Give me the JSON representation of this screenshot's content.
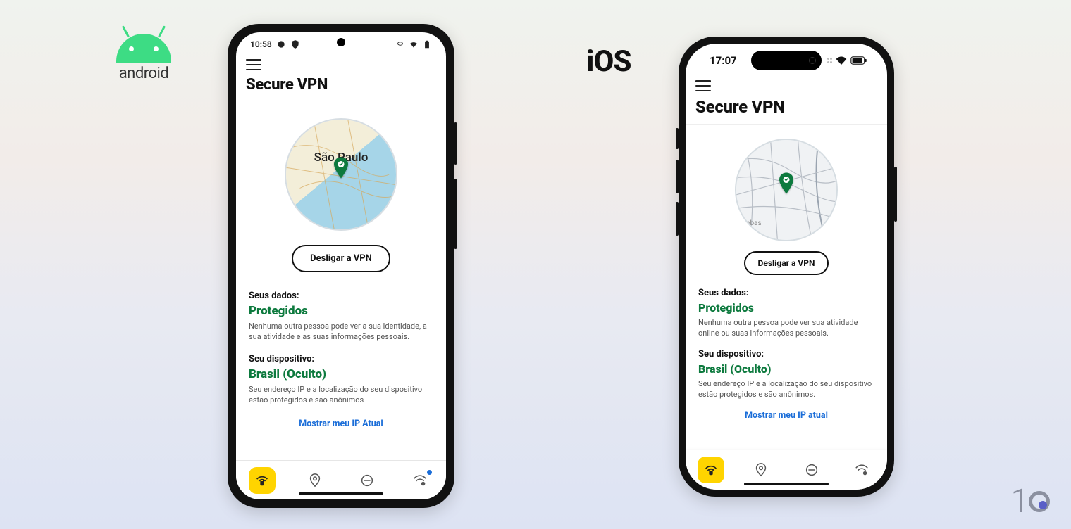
{
  "platforms": {
    "android_label": "android",
    "ios_label": "iOS"
  },
  "watermark": "10",
  "android": {
    "status": {
      "time": "10:58"
    },
    "header": {
      "title": "Secure VPN"
    },
    "map": {
      "city_label": "São Paulo"
    },
    "vpn_button": "Desligar a VPN",
    "data_block": {
      "label": "Seus dados:",
      "status": "Protegidos",
      "desc": "Nenhuma outra pessoa pode ver a sua identidade, a sua atividade e as suas informações pessoais."
    },
    "device_block": {
      "label": "Seu dispositivo:",
      "status": "Brasil (Oculto)",
      "desc": "Seu endereço IP e a localização do seu dispositivo estão protegidos e são anônimos"
    },
    "ip_link": "Mostrar meu IP Atual",
    "nav": {
      "active": 0
    }
  },
  "ios": {
    "status": {
      "time": "17:07"
    },
    "header": {
      "title": "Secure VPN"
    },
    "map": {
      "hint": "abas"
    },
    "vpn_button": "Desligar a VPN",
    "data_block": {
      "label": "Seus dados:",
      "status": "Protegidos",
      "desc": "Nenhuma outra pessoa pode ver sua atividade online ou suas informações pessoais."
    },
    "device_block": {
      "label": "Seu dispositivo:",
      "status": "Brasil (Oculto)",
      "desc": "Seu endereço IP e a localização do seu dispositivo estão protegidos e são anônimos."
    },
    "ip_link": "Mostrar meu IP atual",
    "nav": {
      "active": 0
    }
  }
}
